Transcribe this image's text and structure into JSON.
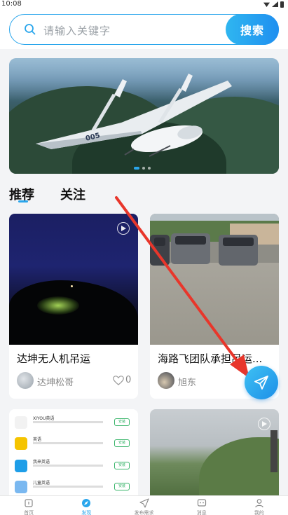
{
  "status_bar": {
    "time": "10:08"
  },
  "search": {
    "placeholder": "请输入关键字",
    "button_label": "搜索"
  },
  "banner": {
    "slides": 3,
    "active_slide": 1
  },
  "tabs": [
    {
      "label": "推荐",
      "active": true
    },
    {
      "label": "关注",
      "active": false
    }
  ],
  "cards": [
    {
      "title": "达坤无人机吊运",
      "author": "达坤松哥",
      "likes": "0",
      "has_video": true
    },
    {
      "title": "海路飞团队承担吊运...",
      "author": "旭东",
      "has_video": false
    },
    {
      "title": "",
      "has_video": false
    },
    {
      "title": "",
      "has_video": true
    }
  ],
  "app_list": [
    {
      "name": "XIYOU英语",
      "action": "安装"
    },
    {
      "name": "英语",
      "action": "安装"
    },
    {
      "name": "我来英语",
      "action": "安装"
    },
    {
      "name": "儿童英语",
      "action": "安装"
    }
  ],
  "bottom_nav": [
    {
      "label": "首页",
      "icon": "home-icon",
      "active": false
    },
    {
      "label": "发现",
      "icon": "discover-icon",
      "active": true
    },
    {
      "label": "发布需求",
      "icon": "send-icon",
      "active": false
    },
    {
      "label": "消息",
      "icon": "message-icon",
      "active": false
    },
    {
      "label": "我的",
      "icon": "profile-icon",
      "active": false
    }
  ],
  "colors": {
    "accent": "#2aa6ec",
    "annotation": "#e8362b"
  }
}
